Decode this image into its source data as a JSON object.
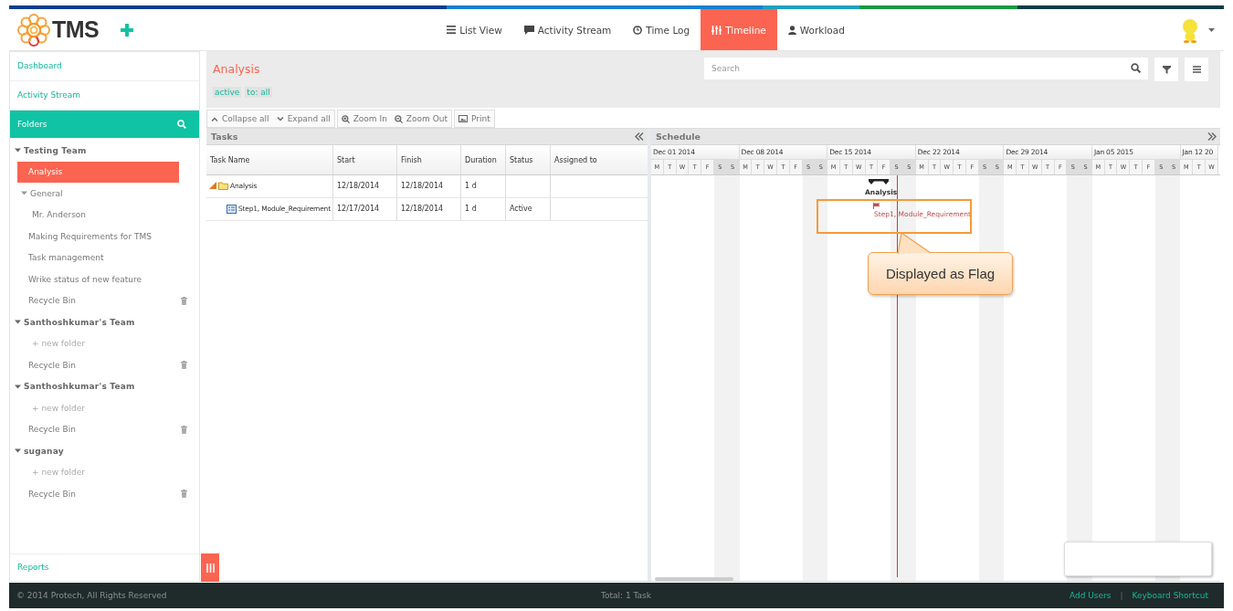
{
  "header": {
    "logo": "TMS",
    "nav": [
      {
        "label": "List View",
        "selected": false
      },
      {
        "label": "Activity Stream",
        "selected": false
      },
      {
        "label": "Time Log",
        "selected": false
      },
      {
        "label": "Timeline",
        "selected": true
      },
      {
        "label": "Workload",
        "selected": false
      }
    ]
  },
  "sidebar": {
    "links": [
      "Dashboard",
      "Activity Stream"
    ],
    "folders_title": "Folders",
    "tree": [
      {
        "label": "Testing Team",
        "kind": "team",
        "selected": false,
        "expanded": true,
        "children": [
          {
            "label": "Analysis",
            "kind": "folder",
            "selected": true
          },
          {
            "label": "General",
            "kind": "folder",
            "selected": false,
            "expanded": true,
            "children": [
              {
                "label": "Mr. Anderson",
                "kind": "folder",
                "selected": false
              }
            ]
          },
          {
            "label": "Making Requirements for TMS",
            "kind": "folder",
            "selected": false
          },
          {
            "label": "Task management",
            "kind": "folder",
            "selected": false
          },
          {
            "label": "Wrike status of new feature",
            "kind": "folder",
            "selected": false
          },
          {
            "label": "Recycle Bin",
            "kind": "bin",
            "selected": false
          }
        ]
      },
      {
        "label": "Santhoshkumar's Team",
        "kind": "team",
        "selected": false,
        "expanded": true,
        "children": [
          {
            "label": "+ new folder",
            "kind": "new",
            "selected": false
          },
          {
            "label": "Recycle Bin",
            "kind": "bin",
            "selected": false
          }
        ]
      },
      {
        "label": "Santhoshkumar's Team",
        "kind": "team",
        "selected": false,
        "expanded": true,
        "children": [
          {
            "label": "+ new folder",
            "kind": "new",
            "selected": false
          },
          {
            "label": "Recycle Bin",
            "kind": "bin",
            "selected": false
          }
        ]
      },
      {
        "label": "suganay",
        "kind": "team",
        "selected": false,
        "expanded": true,
        "children": [
          {
            "label": "+ new folder",
            "kind": "new",
            "selected": false
          },
          {
            "label": "Recycle Bin",
            "kind": "bin",
            "selected": false
          }
        ]
      }
    ],
    "reports": "Reports"
  },
  "main": {
    "title": "Analysis",
    "tags": [
      "active",
      "to: all"
    ],
    "search": {
      "placeholder": "Search"
    },
    "toolbar": [
      "Collapse all",
      "Expand all",
      "Zoom In",
      "Zoom Out",
      "Print"
    ]
  },
  "tasks": {
    "title": "Tasks",
    "columns": [
      "Task Name",
      "Start",
      "Finish",
      "Duration",
      "Status",
      "Assigned to"
    ],
    "rows": [
      {
        "kind": "summary",
        "expanded": true,
        "cells": [
          "Analysis",
          "12/18/2014",
          "12/18/2014",
          "1 d",
          "",
          " "
        ],
        "children": [
          {
            "kind": "task",
            "cells": [
              "Step1, Module_Requirement",
              "12/17/2014",
              "12/18/2014",
              "1 d",
              "Active",
              ""
            ]
          }
        ]
      }
    ]
  },
  "schedule": {
    "title": "Schedule",
    "weeks": [
      {
        "label": "Dec 01 2014",
        "days": [
          "M",
          "T",
          "W",
          "T",
          "F",
          "S",
          "S"
        ]
      },
      {
        "label": "Dec 08 2014",
        "days": [
          "M",
          "T",
          "W",
          "T",
          "F",
          "S",
          "S"
        ]
      },
      {
        "label": "Dec 15 2014",
        "days": [
          "M",
          "T",
          "W",
          "T",
          "F",
          "S",
          "S"
        ]
      },
      {
        "label": "Dec 22 2014",
        "days": [
          "M",
          "T",
          "W",
          "T",
          "F",
          "S",
          "S"
        ]
      },
      {
        "label": "Dec 29 2014",
        "days": [
          "M",
          "T",
          "W",
          "T",
          "F",
          "S",
          "S"
        ]
      },
      {
        "label": "Jan 05 2015",
        "days": [
          "M",
          "T",
          "W",
          "T",
          "F",
          "S",
          "S"
        ]
      },
      {
        "label": "Jan 12 20",
        "days": [
          "M",
          "T",
          "W"
        ]
      }
    ],
    "bars": [
      {
        "label": "Analysis",
        "kind": "summary"
      },
      {
        "label": "Step1, Module_Requirement",
        "kind": "milestone"
      }
    ],
    "callout": "Displayed as Flag"
  },
  "footer": {
    "copyright": "© 2014 Protech, All Rights Reserved",
    "total": "Total: 1 Task",
    "links": [
      "Add Users",
      "Keyboard Shortcut"
    ],
    "separator": "|"
  }
}
